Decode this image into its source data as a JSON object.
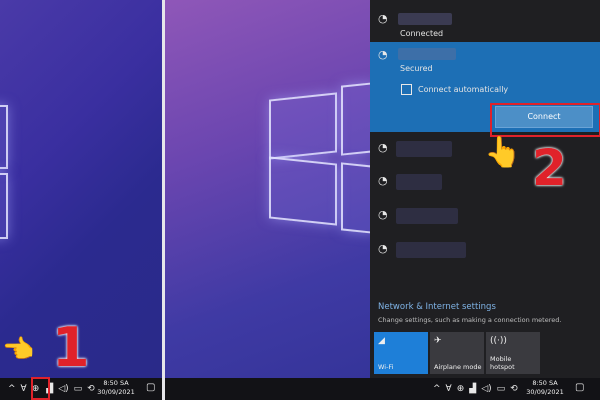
{
  "left_taskbar": {
    "time": "8:50 SA",
    "date": "30/09/2021"
  },
  "right_taskbar": {
    "time": "8:50 SA",
    "date": "30/09/2021"
  },
  "steps": {
    "one": "1",
    "two": "2"
  },
  "flyout": {
    "connected_status": "Connected",
    "secured_status": "Secured",
    "connect_auto_label": "Connect automatically",
    "connect_button": "Connect",
    "settings_title": "Network & Internet settings",
    "settings_desc": "Change settings, such as making a connection metered.",
    "tiles": [
      {
        "label": "Wi-Fi"
      },
      {
        "label": "Airplane mode"
      },
      {
        "label": "Mobile\nhotspot"
      }
    ]
  },
  "colors": {
    "accent": "#1d6fb5",
    "highlight": "#e0222a",
    "wifi_tile": "#1e7fd8"
  }
}
